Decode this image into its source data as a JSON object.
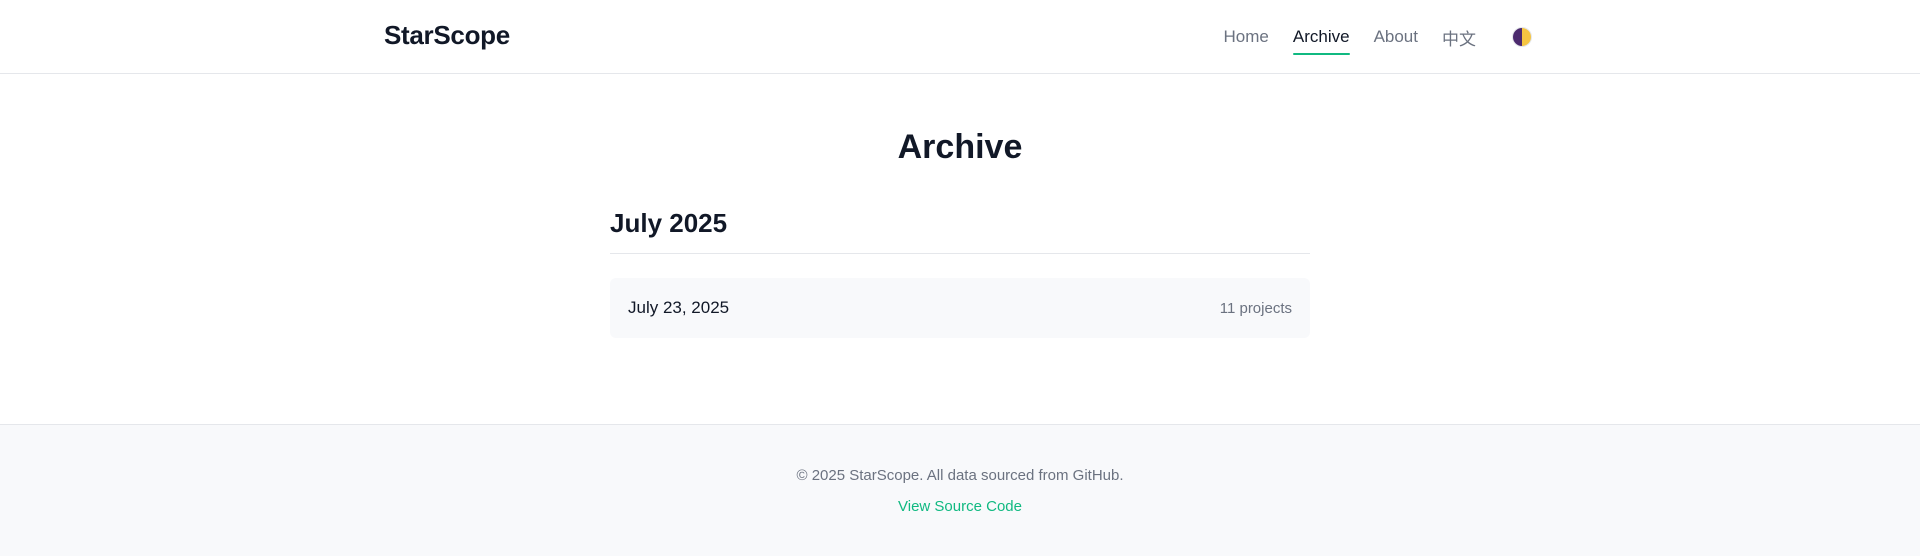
{
  "header": {
    "brand": "StarScope",
    "nav": [
      {
        "label": "Home"
      },
      {
        "label": "Archive",
        "active": true
      },
      {
        "label": "About"
      },
      {
        "label": "中文"
      }
    ],
    "theme_toggle_icon": "half-moon-theme-icon"
  },
  "main": {
    "title": "Archive",
    "sections": [
      {
        "month": "July 2025",
        "entries": [
          {
            "date": "July 23, 2025",
            "count": "11 projects"
          }
        ]
      }
    ]
  },
  "footer": {
    "copyright": "© 2025 StarScope. All data sourced from GitHub.",
    "source_link": "View Source Code"
  },
  "colors": {
    "accent": "#10b981",
    "text": "#111827",
    "muted": "#6b7280",
    "border": "#e5e7eb",
    "panel": "#f8f9fb"
  }
}
